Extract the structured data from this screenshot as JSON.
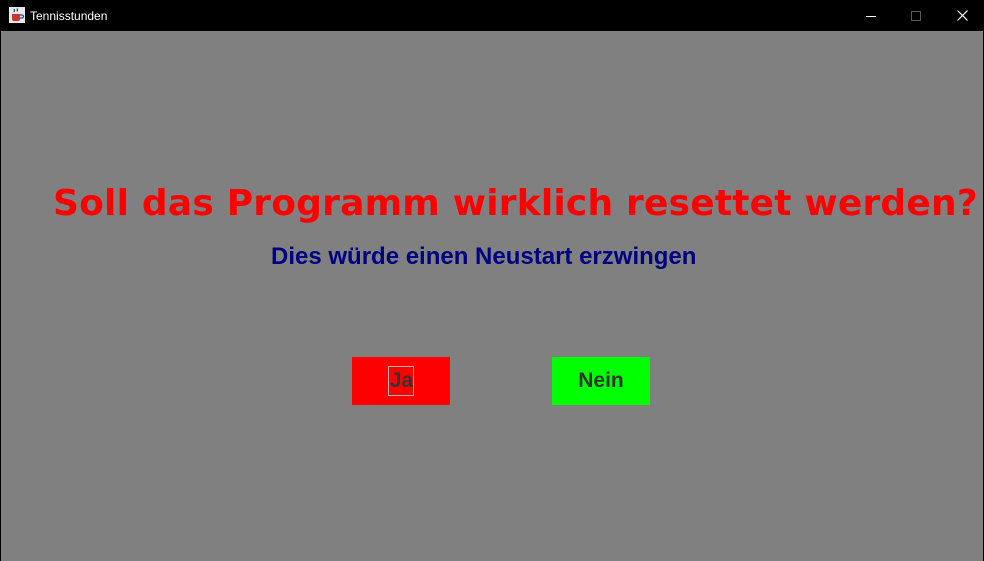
{
  "window": {
    "title": "Tennisstunden",
    "icon": "java-coffee-cup-icon",
    "controls": [
      "minimize-icon",
      "maximize-icon",
      "close-icon"
    ]
  },
  "dialog": {
    "question": "Soll das Programm wirklich resettet werden?",
    "hint": "Dies würde einen Neustart erzwingen",
    "yes_label": "Ja",
    "no_label": "Nein"
  },
  "colors": {
    "background": "#808080",
    "question": "#ff0000",
    "hint": "#000080",
    "yes_button": "#ff0000",
    "no_button": "#00ff00"
  },
  "focused_button": "Ja"
}
